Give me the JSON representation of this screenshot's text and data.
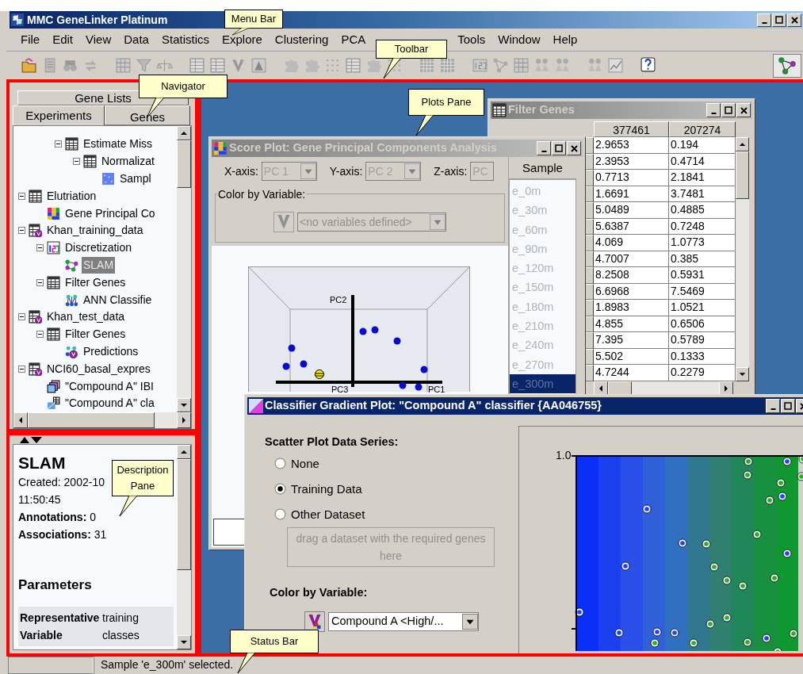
{
  "window": {
    "title": "MMC GeneLinker Platinum"
  },
  "menu": [
    {
      "label": "File"
    },
    {
      "label": "Edit"
    },
    {
      "label": "View"
    },
    {
      "label": "Data"
    },
    {
      "label": "Statistics"
    },
    {
      "label": "Explore"
    },
    {
      "label": "Clustering"
    },
    {
      "label": "PCA"
    },
    {
      "label": "Tools"
    },
    {
      "label": "Window"
    },
    {
      "label": "Help"
    }
  ],
  "callouts": [
    {
      "text": "Menu Bar"
    },
    {
      "text": "Toolbar"
    },
    {
      "text": "Navigator"
    },
    {
      "text": "Plots Pane"
    },
    {
      "text": "Description Pane"
    },
    {
      "text": "Status Bar"
    }
  ],
  "navigator": {
    "tabs": [
      {
        "label": "Gene Lists",
        "selected": false
      },
      {
        "label": "Experiments",
        "selected": true
      },
      {
        "label": "Genes",
        "selected": false
      }
    ],
    "tree": [
      {
        "children": [
          {
            "children": [
              {
                "label": "Estimate Miss",
                "kind": "table",
                "expanded": true,
                "selected": false,
                "children": [
                  {
                    "label": "Normalizat",
                    "kind": "table",
                    "expanded": true,
                    "selected": false,
                    "children": [
                      {
                        "label": "Sampl",
                        "kind": "heatmap",
                        "selected": false
                      }
                    ]
                  }
                ]
              }
            ]
          }
        ]
      },
      {
        "label": "Elutriation",
        "kind": "table",
        "expanded": true,
        "selected": false,
        "children": [
          {
            "label": "Gene Principal Co",
            "kind": "pca",
            "selected": false
          }
        ]
      },
      {
        "label": "Khan_training_data",
        "kind": "variable-table",
        "expanded": true,
        "selected": false,
        "children": [
          {
            "label": "Discretization",
            "kind": "numbers",
            "expanded": true,
            "selected": false,
            "children": [
              {
                "label": "SLAM",
                "kind": "network",
                "selected": true
              }
            ]
          },
          {
            "label": "Filter Genes",
            "kind": "table",
            "expanded": true,
            "selected": false,
            "children": [
              {
                "label": "ANN Classifie",
                "kind": "ann",
                "selected": false
              }
            ]
          }
        ]
      },
      {
        "label": "Khan_test_data",
        "kind": "variable-table",
        "expanded": true,
        "selected": false,
        "children": [
          {
            "label": "Filter Genes",
            "kind": "table",
            "expanded": true,
            "selected": false,
            "children": [
              {
                "label": "Predictions",
                "kind": "prediction",
                "selected": false
              }
            ]
          }
        ]
      },
      {
        "label": "NCI60_basal_expres",
        "kind": "variable-table",
        "expanded": true,
        "selected": false,
        "children": [
          {
            "label": "\"Compound A\" IBI",
            "kind": "stack",
            "selected": false
          },
          {
            "label": "\"Compound A\" cla",
            "kind": "classifier",
            "selected": false
          }
        ]
      }
    ]
  },
  "description": {
    "title": "SLAM",
    "lines": [
      "Created: 2002-10",
      "11:50:45",
      "**Annotations:** 0",
      "**Associations:** 31"
    ],
    "section": "Parameters",
    "params": [
      {
        "name": "Representative Variable",
        "value": "training classes"
      }
    ]
  },
  "filter_genes": {
    "title": "Filter Genes",
    "active": false,
    "columns": [
      "377461",
      "207274"
    ],
    "rows": [
      [
        "2.9653",
        "0.194"
      ],
      [
        "2.3953",
        "0.4714"
      ],
      [
        "0.7713",
        "2.1841"
      ],
      [
        "1.6691",
        "3.7481"
      ],
      [
        "5.0489",
        "0.4885"
      ],
      [
        "5.6387",
        "0.7248"
      ],
      [
        "4.069",
        "1.0773"
      ],
      [
        "4.7007",
        "0.385"
      ],
      [
        "8.2508",
        "0.5931"
      ],
      [
        "6.6968",
        "7.5469"
      ],
      [
        "1.8983",
        "1.0521"
      ],
      [
        "4.855",
        "0.6506"
      ],
      [
        "7.395",
        "0.5789"
      ],
      [
        "5.502",
        "0.1333"
      ],
      [
        "4.7244",
        "0.2279"
      ]
    ]
  },
  "score_plot": {
    "title": "Score Plot: Gene Principal Components Analysis",
    "active": false,
    "axes": [
      {
        "label": "X-axis:",
        "value": "PC 1"
      },
      {
        "label": "Y-axis:",
        "value": "PC 2"
      },
      {
        "label": "Z-axis:",
        "value": "PC"
      }
    ],
    "color_group": {
      "legend": "Color by Variable:",
      "value": "<no variables defined>",
      "disabled": true
    },
    "axis_labels": [
      "PC2",
      "PC3",
      "PC1"
    ],
    "sample_list": {
      "header": "Sample",
      "disabled": true,
      "items": [
        {
          "label": "e_0m",
          "selected": false
        },
        {
          "label": "e_30m",
          "selected": false
        },
        {
          "label": "e_60m",
          "selected": false
        },
        {
          "label": "e_90m",
          "selected": false
        },
        {
          "label": "e_120m",
          "selected": false
        },
        {
          "label": "e_150m",
          "selected": false
        },
        {
          "label": "e_180m",
          "selected": false
        },
        {
          "label": "e_210m",
          "selected": false
        },
        {
          "label": "e_240m",
          "selected": false
        },
        {
          "label": "e_270m",
          "selected": false
        },
        {
          "label": "e_300m",
          "selected": true
        }
      ]
    }
  },
  "classifier": {
    "title": "Classifier Gradient Plot: \"Compound A\" classifier {AA046755}",
    "active": true,
    "series_label": "Scatter Plot Data Series:",
    "options": [
      {
        "label": "None",
        "selected": false
      },
      {
        "label": "Training Data",
        "selected": true
      },
      {
        "label": "Other Dataset",
        "selected": false
      }
    ],
    "drop_hint": "drag a dataset with the required genes here",
    "color_label": "Color by Variable:",
    "color_value": "Compound A <High/...",
    "y_tick": "1.0"
  },
  "status_bar": {
    "text": "Sample 'e_300m' selected."
  }
}
